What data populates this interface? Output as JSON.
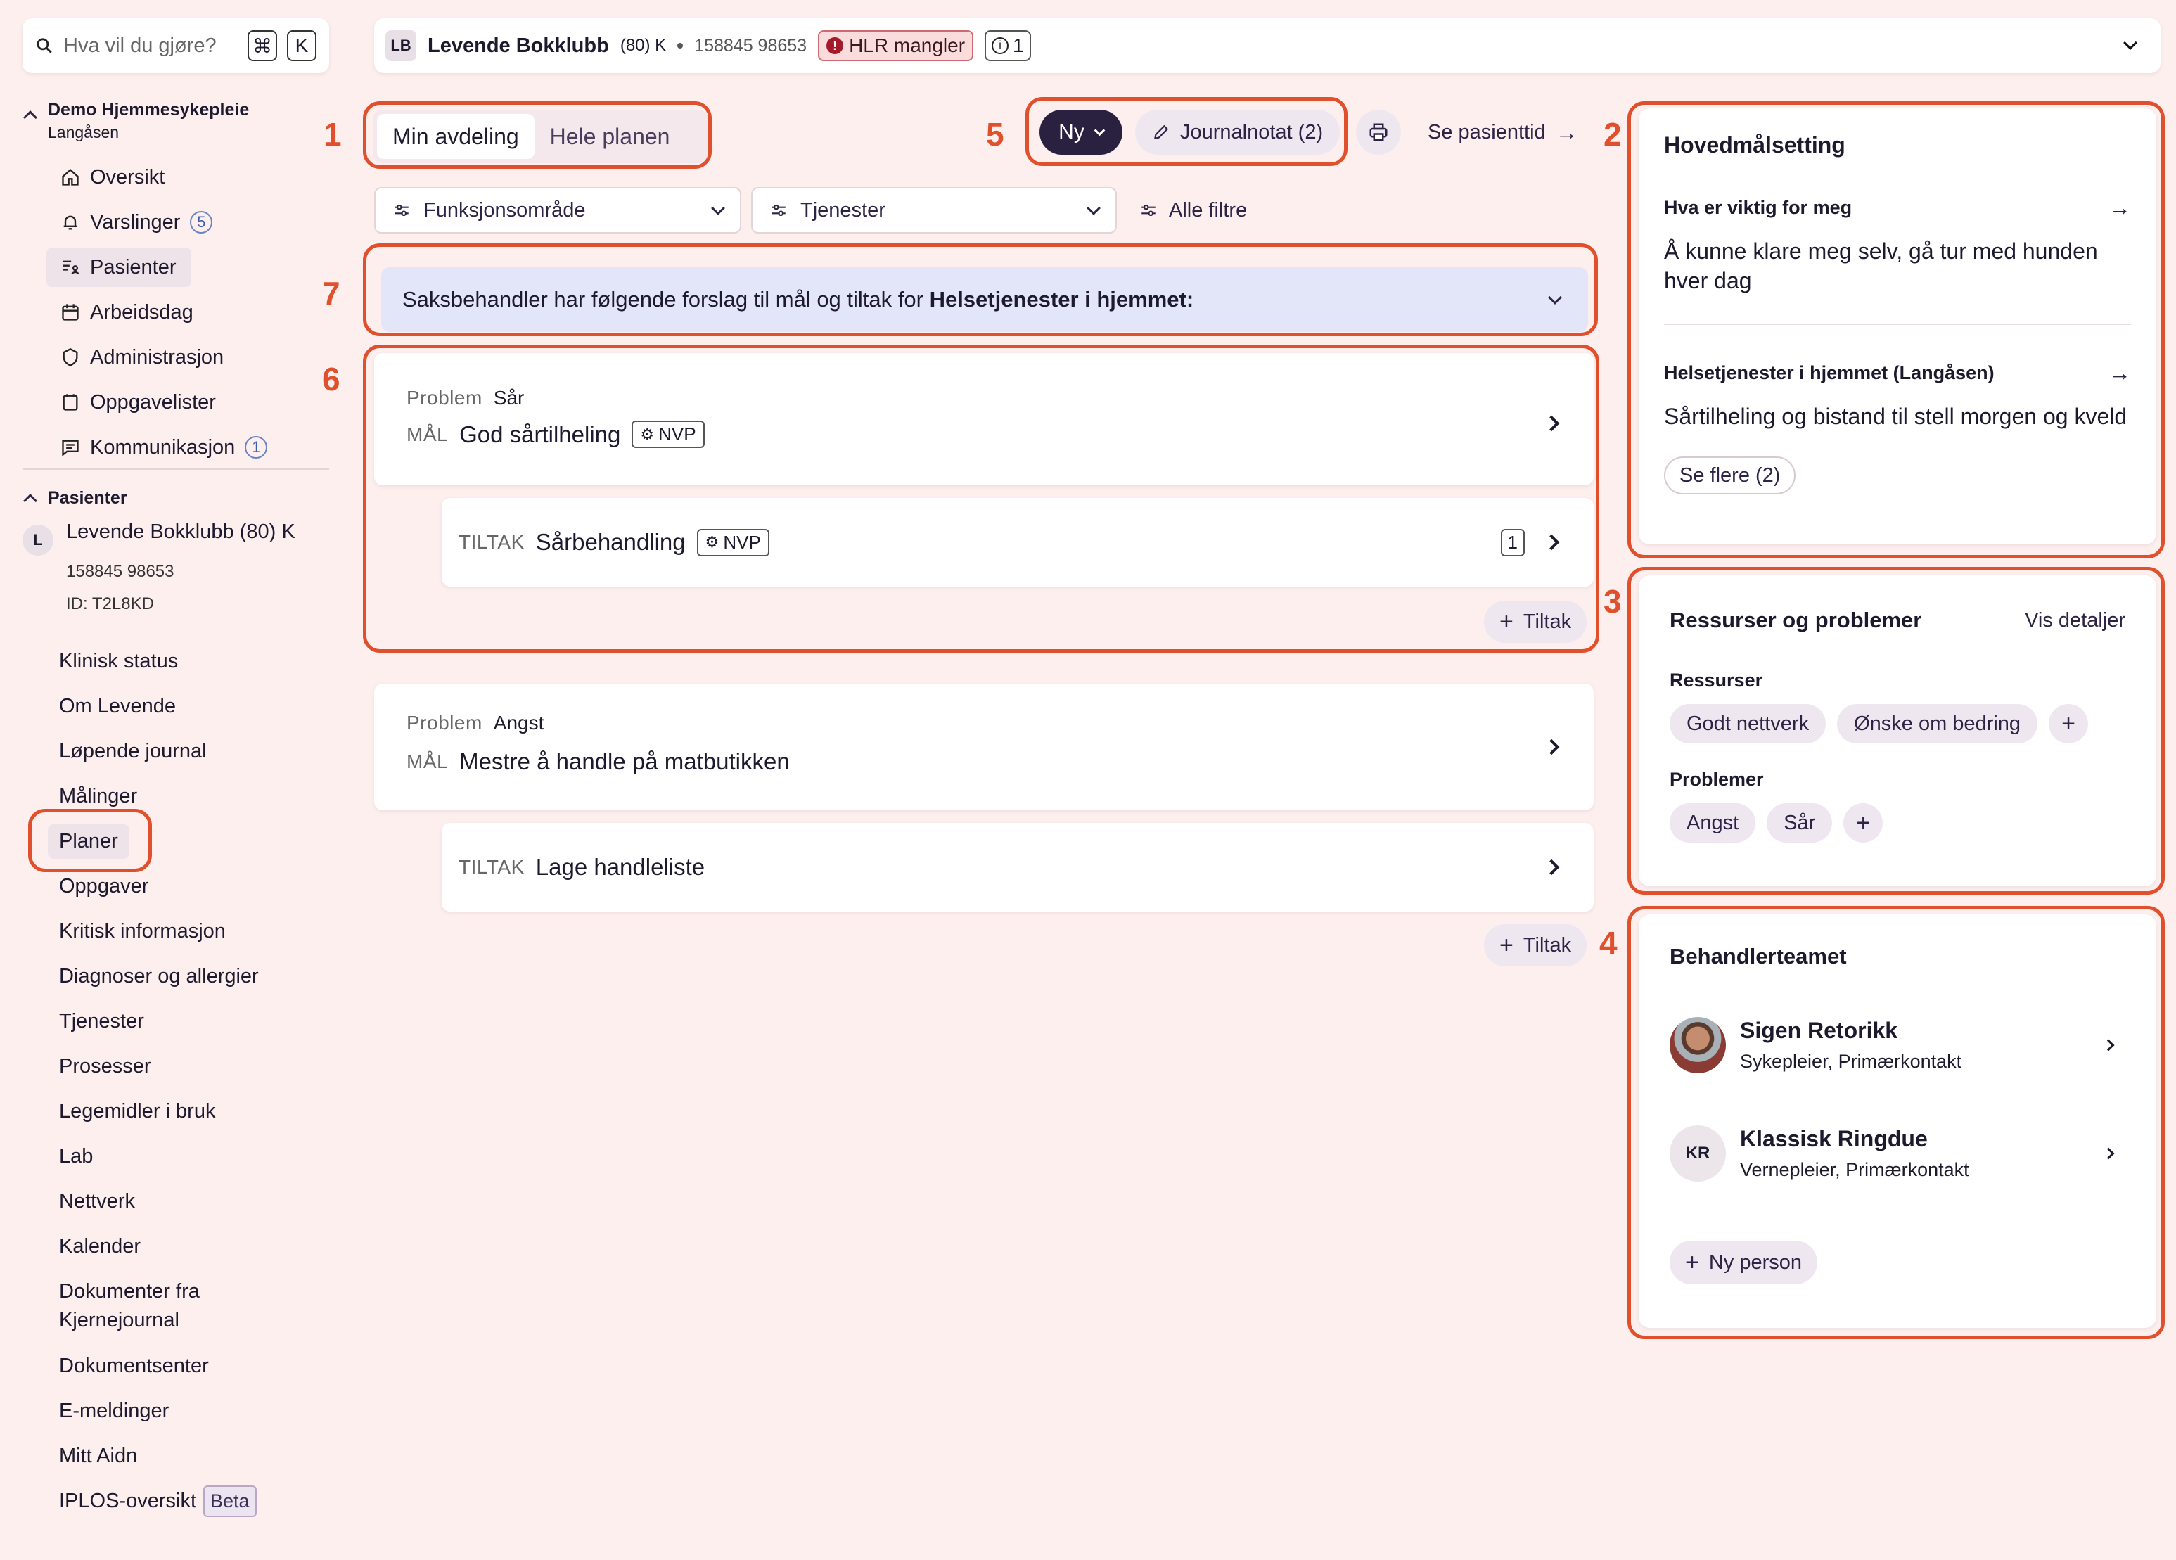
{
  "search": {
    "placeholder": "Hva vil du gjøre?",
    "key1": "⌘",
    "key2": "K"
  },
  "org": {
    "name": "Demo Hjemmesykepleie",
    "sub": "Langåsen"
  },
  "menu": [
    {
      "label": "Oversikt",
      "icon": "home-icon"
    },
    {
      "label": "Varslinger",
      "icon": "bell-icon",
      "count": "5"
    },
    {
      "label": "Pasienter",
      "icon": "patients-icon",
      "active": true
    },
    {
      "label": "Arbeidsdag",
      "icon": "calendar-icon"
    },
    {
      "label": "Administrasjon",
      "icon": "shield-icon"
    },
    {
      "label": "Oppgavelister",
      "icon": "tasklist-icon"
    },
    {
      "label": "Kommunikasjon",
      "icon": "message-icon",
      "count": "1"
    }
  ],
  "patients_section": "Pasienter",
  "patient": {
    "initial": "L",
    "name": "Levende Bokklubb (80) K",
    "ssn": "158845 98653",
    "id": "ID: T2L8KD"
  },
  "patient_nav": [
    "Klinisk status",
    "Om Levende",
    "Løpende journal",
    "Målinger",
    "Planer",
    "Oppgaver",
    "Kritisk informasjon",
    "Diagnoser og allergier",
    "Tjenester",
    "Prosesser",
    "Legemidler i bruk",
    "Lab",
    "Nettverk",
    "Kalender",
    "Dokumenter fra Kjernejournal",
    "Dokumentsenter",
    "E-meldinger",
    "Mitt Aidn",
    "IPLOS-oversikt"
  ],
  "beta_label": "Beta",
  "header": {
    "initials": "LB",
    "name": "Levende Bokklubb",
    "age": "(80) K",
    "ssn": "158845 98653",
    "hlr": "HLR mangler",
    "info_count": "1"
  },
  "tabs": [
    "Min avdeling",
    "Hele planen"
  ],
  "actions": {
    "new": "Ny",
    "journal": "Journalnotat (2)",
    "timeline": "Se pasienttid"
  },
  "filters": [
    "Funksjonsområde",
    "Tjenester"
  ],
  "all_filters": "Alle filtre",
  "banner": {
    "text": "Saksbehandler har følgende forslag til mål og tiltak for ",
    "bold": "Helsetjenester i hjemmet:"
  },
  "plans": [
    {
      "problem_label": "Problem",
      "problem": "Sår",
      "goal_label": "MÅL",
      "goal": "God sårtilheling",
      "goal_badge": "NVP",
      "measure_label": "TILTAK",
      "measure": "Sårbehandling",
      "measure_badge": "NVP",
      "measure_count": "1",
      "add": "Tiltak"
    },
    {
      "problem_label": "Problem",
      "problem": "Angst",
      "goal_label": "MÅL",
      "goal": "Mestre å handle på matbutikken",
      "measure_label": "TILTAK",
      "measure": "Lage handleliste",
      "add": "Tiltak"
    }
  ],
  "goals": {
    "title": "Hovedmålsetting",
    "items": [
      {
        "heading": "Hva er viktig for meg",
        "text": "Å kunne klare meg selv, gå tur med hunden hver dag"
      },
      {
        "heading": "Helsetjenester i hjemmet (Langåsen)",
        "text": "Sårtilheling og bistand til stell morgen og kveld"
      }
    ],
    "more": "Se flere (2)"
  },
  "resources": {
    "title": "Ressurser og problemer",
    "details": "Vis detaljer",
    "res_label": "Ressurser",
    "res": [
      "Godt nettverk",
      "Ønske om bedring"
    ],
    "prob_label": "Problemer",
    "probs": [
      "Angst",
      "Sår"
    ]
  },
  "team": {
    "title": "Behandlerteamet",
    "members": [
      {
        "name": "Sigen Retorikk",
        "role": "Sykepleier, Primærkontakt"
      },
      {
        "name": "Klassisk Ringdue",
        "role": "Vernepleier, Primærkontakt",
        "initials": "KR"
      }
    ],
    "add": "Ny person"
  },
  "annotations": [
    "1",
    "2",
    "3",
    "4",
    "5",
    "6",
    "7"
  ],
  "colors": {
    "background": "#fcefee",
    "highlight": "#e0502c",
    "accent_dark": "#2a2140",
    "banner": "#e3e6f8",
    "pill": "#efe7f0"
  }
}
